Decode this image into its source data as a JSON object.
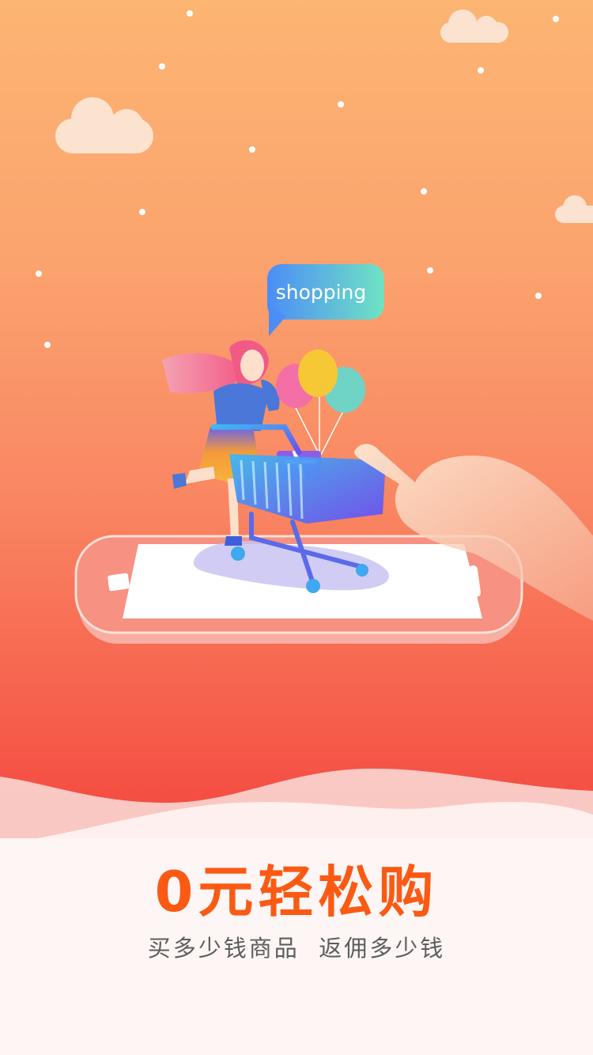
{
  "illustration": {
    "bubble_text": "shopping"
  },
  "promo": {
    "headline": "0元轻松购",
    "subline": "买多少钱商品  返佣多少钱"
  },
  "colors": {
    "headline": "#fb5a14",
    "subline": "#5d5d5d",
    "bg_top": "#fcb573",
    "bg_bottom": "#f4443e"
  }
}
